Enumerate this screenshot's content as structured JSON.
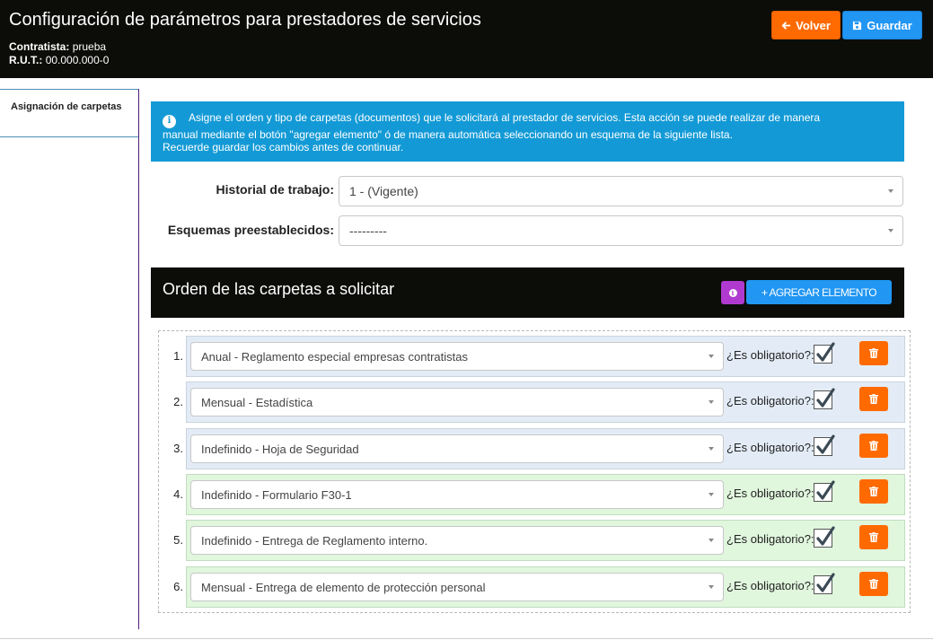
{
  "header": {
    "title": "Configuración de parámetros para prestadores de servicios",
    "contratista_label": "Contratista:",
    "contratista_value": "prueba",
    "rut_label": "R.U.T.:",
    "rut_value": "00.000.000-0",
    "back_label": "Volver",
    "save_label": "Guardar"
  },
  "sidebar": {
    "items": [
      {
        "label": "Asignación de carpetas"
      }
    ]
  },
  "alert": {
    "line1": "Asigne el orden y tipo de carpetas (documentos) que le solicitará al prestador de servicios. Esta acción se puede realizar de manera",
    "line2": "manual mediante el botón \"agregar elemento\" ó de manera automática seleccionando un esquema de la siguiente lista.",
    "line3": "Recuerde guardar los cambios antes de continuar."
  },
  "form": {
    "historial_label": "Historial de trabajo:",
    "historial_value": "1 - (Vigente)",
    "esquemas_label": "Esquemas preestablecidos:",
    "esquemas_value": "---------"
  },
  "section": {
    "title": "Orden de las carpetas a solicitar",
    "add_label": "+ AGREGAR ELEMENTO"
  },
  "items": [
    {
      "number": "1.",
      "value": "Anual - Reglamento especial empresas contratistas",
      "oblig_label": "¿Es obligatorio?:",
      "checked": true
    },
    {
      "number": "2.",
      "value": "Mensual - Estadística",
      "oblig_label": "¿Es obligatorio?:",
      "checked": true
    },
    {
      "number": "3.",
      "value": "Indefinido - Hoja de Seguridad",
      "oblig_label": "¿Es obligatorio?:",
      "checked": true
    },
    {
      "number": "4.",
      "value": "Indefinido - Formulario F30-1",
      "oblig_label": "¿Es obligatorio?:",
      "checked": true
    },
    {
      "number": "5.",
      "value": "Indefinido - Entrega de Reglamento interno.",
      "oblig_label": "¿Es obligatorio?:",
      "checked": true
    },
    {
      "number": "6.",
      "value": "Mensual - Entrega de elemento de protección personal",
      "oblig_label": "¿Es obligatorio?:",
      "checked": true
    }
  ],
  "colors": {
    "header_bg": "#0c0d09",
    "alert_bg": "#139ad6",
    "orange": "#ff6a00",
    "blue": "#2196f3",
    "purple": "#b03ad0",
    "row_blue": "#e3ecf6",
    "row_green": "#e0f6dd"
  }
}
